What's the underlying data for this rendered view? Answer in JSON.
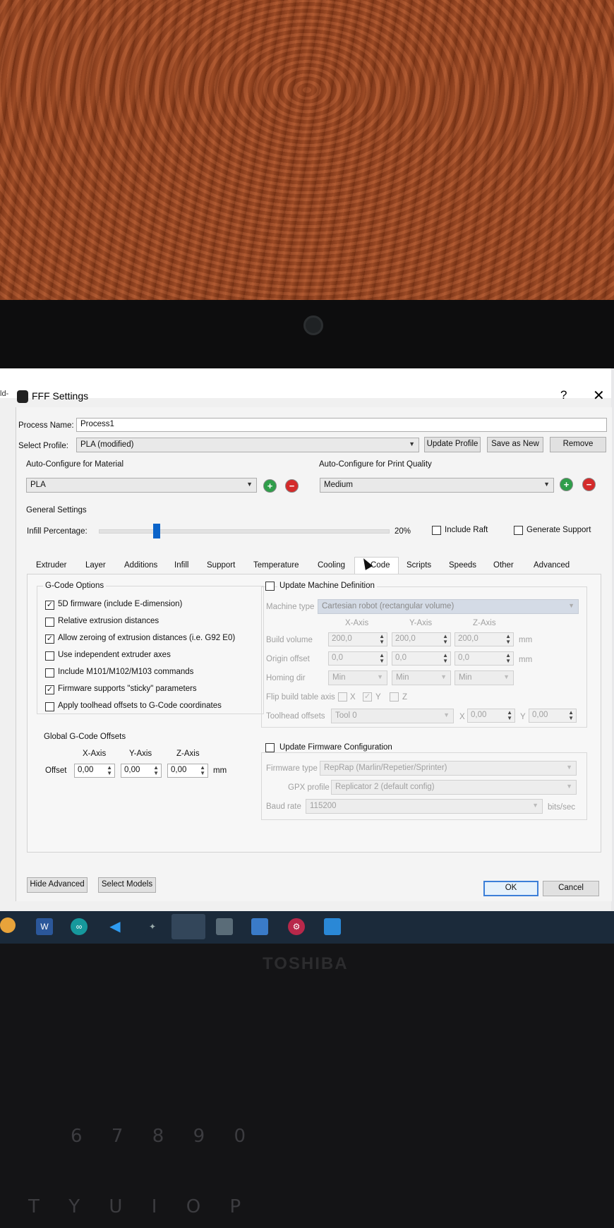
{
  "dialog": {
    "title": "FFF Settings",
    "help": "?",
    "close": "✕",
    "edge_fragment": "ld-"
  },
  "process": {
    "name_label": "Process Name:",
    "name_value": "Process1"
  },
  "profile": {
    "label": "Select Profile:",
    "value": "PLA (modified)",
    "update": "Update Profile",
    "save_new": "Save as New",
    "remove": "Remove"
  },
  "material": {
    "label": "Auto-Configure for Material",
    "value": "PLA"
  },
  "quality": {
    "label": "Auto-Configure for Print Quality",
    "value": "Medium"
  },
  "general": {
    "label": "General Settings",
    "infill_label": "Infill Percentage:",
    "infill_percent": 20,
    "infill_text": "20%",
    "include_raft": "Include Raft",
    "generate_support": "Generate Support"
  },
  "tabs": [
    "Extruder",
    "Layer",
    "Additions",
    "Infill",
    "Support",
    "Temperature",
    "Cooling",
    "G-Code",
    "Scripts",
    "Speeds",
    "Other",
    "Advanced"
  ],
  "active_tab_visible": "Code",
  "gcode_options": {
    "title": "G-Code Options",
    "items": [
      {
        "label": "5D firmware (include E-dimension)",
        "checked": true
      },
      {
        "label": "Relative extrusion distances",
        "checked": false
      },
      {
        "label": "Allow zeroing of extrusion distances (i.e. G92 E0)",
        "checked": true
      },
      {
        "label": "Use independent extruder axes",
        "checked": false
      },
      {
        "label": "Include M101/M102/M103 commands",
        "checked": false
      },
      {
        "label": "Firmware supports \"sticky\" parameters",
        "checked": true
      },
      {
        "label": "Apply toolhead offsets to G-Code coordinates",
        "checked": false
      }
    ]
  },
  "offsets": {
    "title": "Global G-Code Offsets",
    "x_label": "X-Axis",
    "y_label": "Y-Axis",
    "z_label": "Z-Axis",
    "row_label": "Offset",
    "x": "0,00",
    "y": "0,00",
    "z": "0,00",
    "unit": "mm"
  },
  "machine": {
    "update_label": "Update Machine Definition",
    "type_label": "Machine type",
    "type_value": "Cartesian robot (rectangular volume)",
    "x_axis": "X-Axis",
    "y_axis": "Y-Axis",
    "z_axis": "Z-Axis",
    "build_label": "Build volume",
    "build": [
      "200,0",
      "200,0",
      "200,0"
    ],
    "origin_label": "Origin offset",
    "origin": [
      "0,0",
      "0,0",
      "0,0"
    ],
    "unit": "mm",
    "homing_label": "Homing dir",
    "homing": [
      "Min",
      "Min",
      "Min"
    ],
    "flip_label": "Flip build table axis",
    "flip_x": "X",
    "flip_y": "Y",
    "flip_z": "Z",
    "toolhead_label": "Toolhead offsets",
    "toolhead_value": "Tool 0",
    "th_x_label": "X",
    "th_x": "0,00",
    "th_y_label": "Y",
    "th_y": "0,00"
  },
  "firmware": {
    "update_label": "Update Firmware Configuration",
    "type_label": "Firmware type",
    "type_value": "RepRap (Marlin/Repetier/Sprinter)",
    "gpx_label": "GPX profile",
    "gpx_value": "Replicator 2 (default config)",
    "baud_label": "Baud rate",
    "baud_value": "115200",
    "baud_unit": "bits/sec"
  },
  "footer": {
    "hide_advanced": "Hide Advanced",
    "select_models": "Select Models",
    "ok": "OK",
    "cancel": "Cancel"
  },
  "laptop": {
    "brand": "TOSHIBA"
  }
}
